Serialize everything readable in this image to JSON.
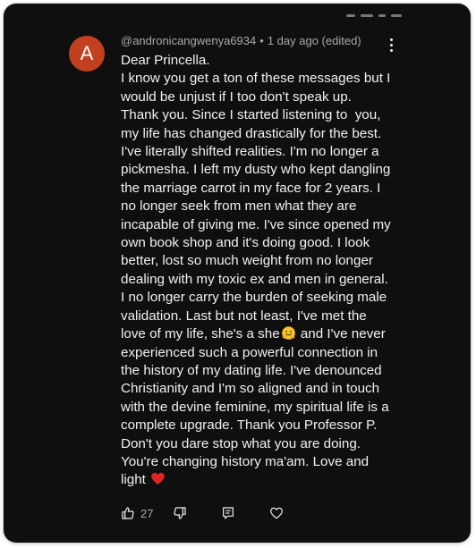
{
  "comment": {
    "avatar_letter": "A",
    "author": "@andronicangwenya6934",
    "separator": "•",
    "time": "1 day ago (edited)",
    "text_before_emoji": "Dear Princella.\nI know you get a ton of these messages but I would be unjust if I too don't speak up. Thank you. Since I started listening to  you, my life has changed drastically for the best. I've literally shifted realities. I'm no longer a pickmesha. I left my dusty who kept dangling the marriage carrot in my face for 2 years. I no longer seek from men what they are incapable of giving me. I've since opened my own book shop and it's doing good. I look better, lost so much weight from no longer dealing with my toxic ex and men in general. I no longer carry the burden of seeking male validation. Last but not least, I've met the love of my life, she's a she",
    "text_after_emoji": " and I've never experienced such a powerful connection in the history of my dating life. I've denounced Christianity and I'm so aligned and in touch with the devine feminine, my spiritual life is a complete upgrade. Thank you Professor P. Don't you dare stop what you are doing. You're changing history ma'am. Love and light ",
    "like_count": "27"
  },
  "colors": {
    "background": "#0f0f0f",
    "avatar": "#c2401f",
    "text": "#f1f1f1",
    "meta": "#aaaaaa",
    "heart": "#e02424"
  },
  "icons": {
    "menu": "more-vert-icon",
    "like": "thumbs-up-icon",
    "dislike": "thumbs-down-icon",
    "reply": "reply-icon",
    "heart_action": "heart-outline-icon",
    "hug_emoji": "hugging-face-emoji-icon",
    "red_heart_emoji": "red-heart-emoji-icon"
  }
}
